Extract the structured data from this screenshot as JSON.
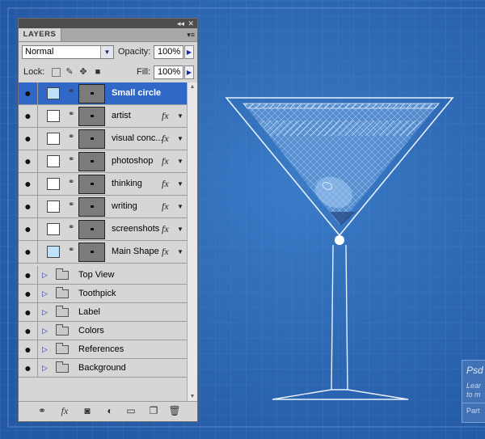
{
  "panel": {
    "tab_label": "LAYERS",
    "dock_collapse": "◂◂",
    "dock_close": "✕",
    "menu_icon": "▾≡",
    "blend_mode": "Normal",
    "opacity_label": "Opacity:",
    "opacity_value": "100%",
    "lock_label": "Lock:",
    "fill_label": "Fill:",
    "fill_value": "100%"
  },
  "layers": [
    {
      "name": "Small circle",
      "selected": true,
      "fx": false,
      "tint": true
    },
    {
      "name": "artist",
      "selected": false,
      "fx": true
    },
    {
      "name": "visual conc...",
      "selected": false,
      "fx": true
    },
    {
      "name": "photoshop",
      "selected": false,
      "fx": true
    },
    {
      "name": "thinking",
      "selected": false,
      "fx": true
    },
    {
      "name": "writing",
      "selected": false,
      "fx": true
    },
    {
      "name": "screenshots",
      "selected": false,
      "fx": true
    },
    {
      "name": "Main Shape",
      "selected": false,
      "fx": true,
      "tint": true
    }
  ],
  "groups": [
    {
      "name": "Top View"
    },
    {
      "name": "Toothpick"
    },
    {
      "name": "Label"
    },
    {
      "name": "Colors"
    },
    {
      "name": "References"
    },
    {
      "name": "Background"
    }
  ],
  "footer_icons": [
    "link-icon",
    "fx-icon",
    "mask-icon",
    "adjustment-icon",
    "folder-icon",
    "new-layer-icon",
    "trash-icon"
  ],
  "fx_text": "fx",
  "promo": {
    "title": "Psd",
    "line1": "Lear",
    "line2": "to m",
    "line3": "Part"
  },
  "colors": {
    "canvas_blue": "#2f69b4",
    "selection": "#3167c6",
    "panel_gray": "#d6d6d6"
  }
}
